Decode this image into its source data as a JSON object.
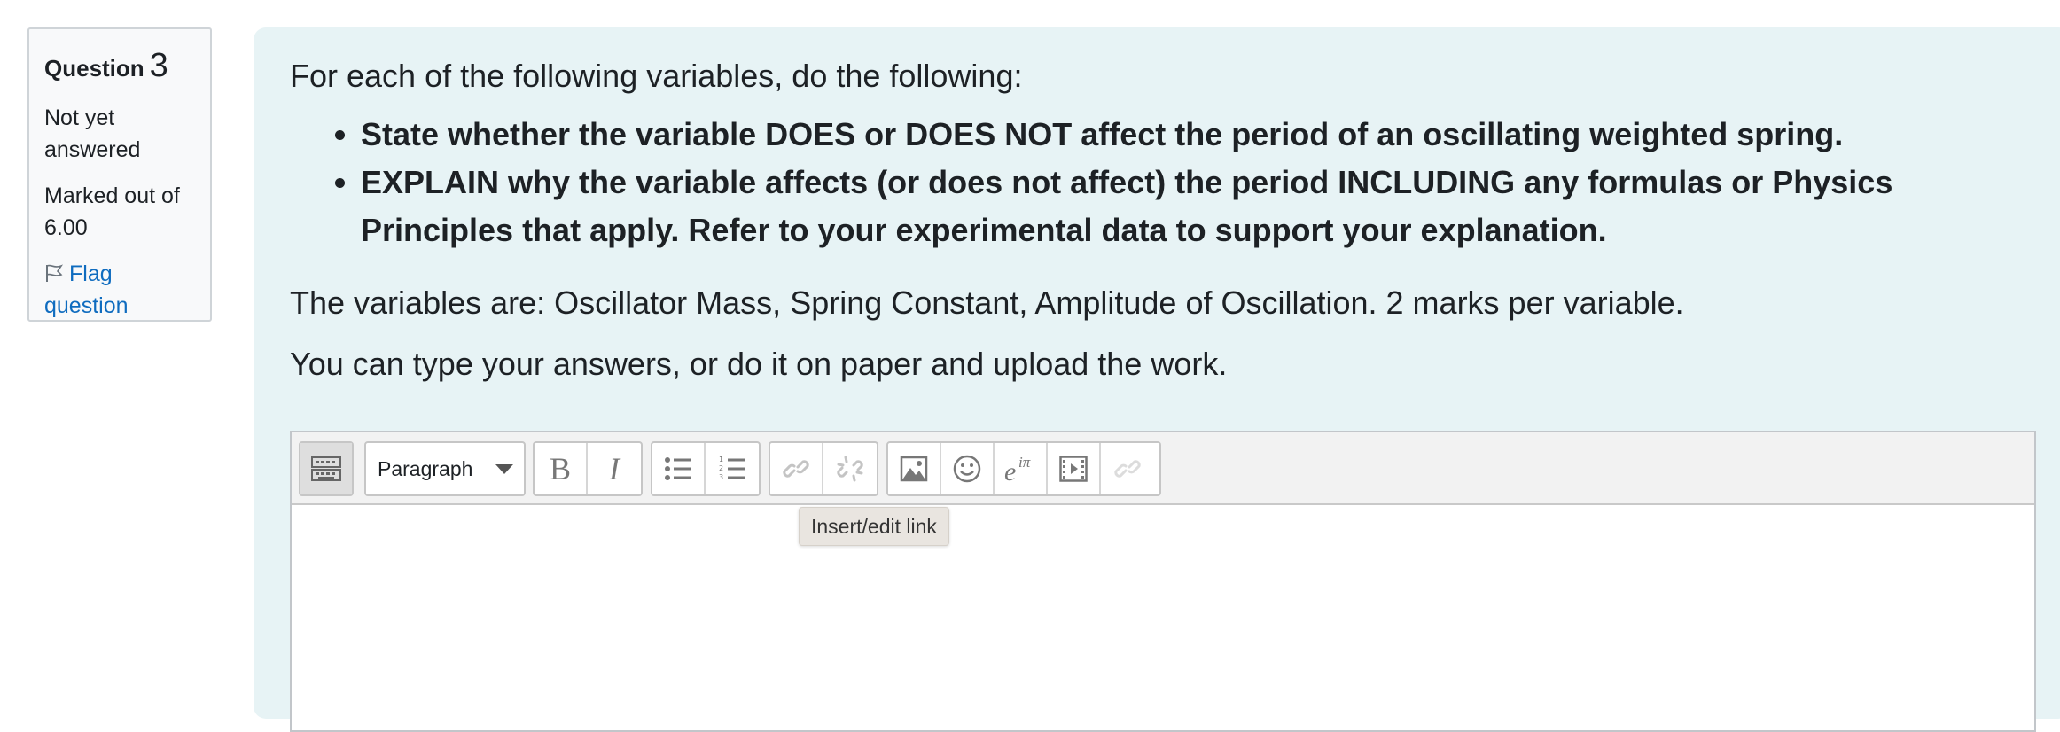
{
  "info": {
    "question_label": "Question",
    "question_number": "3",
    "state": "Not yet answered",
    "grade": "Marked out of 6.00",
    "flag_label": "Flag question"
  },
  "question": {
    "intro": "For each of the following variables, do the following:",
    "bullets": [
      "State whether the variable DOES or DOES NOT affect the period of an oscillating weighted spring.",
      "EXPLAIN why the variable affects (or does not affect) the period INCLUDING any formulas or Physics Principles that apply.  Refer to your experimental data to support your explanation."
    ],
    "variables_text": "The variables are:  Oscillator Mass, Spring Constant, Amplitude of Oscillation.  2 marks per variable.",
    "upload_text": "You can type your answers, or do it on paper and upload the work."
  },
  "editor": {
    "paragraph_select": "Paragraph",
    "tooltip": "Insert/edit link",
    "buttons": [
      "toolbar-toggle",
      "bold",
      "italic",
      "unordered-list",
      "ordered-list",
      "link",
      "unlink",
      "image",
      "emoji",
      "equation",
      "media",
      "manage-files"
    ]
  }
}
